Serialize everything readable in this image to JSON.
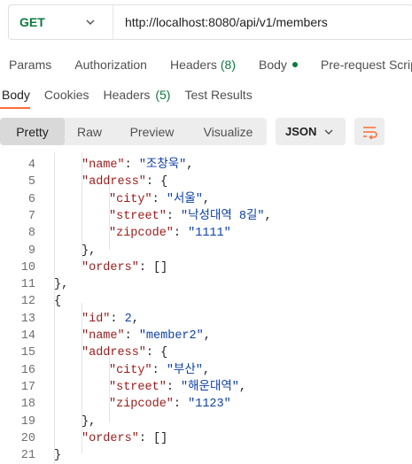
{
  "request": {
    "method": "GET",
    "url": "http://localhost:8080/api/v1/members"
  },
  "request_tabs": [
    {
      "label": "Params",
      "count": ""
    },
    {
      "label": "Authorization",
      "count": ""
    },
    {
      "label": "Headers",
      "count": "(8)"
    },
    {
      "label": "Body",
      "count": ""
    },
    {
      "label": "Pre-request Script",
      "count": ""
    }
  ],
  "response_tabs": [
    {
      "label": "Body",
      "count": ""
    },
    {
      "label": "Cookies",
      "count": ""
    },
    {
      "label": "Headers",
      "count": "(5)"
    },
    {
      "label": "Test Results",
      "count": ""
    }
  ],
  "format_toolbar": {
    "views": [
      "Pretty",
      "Raw",
      "Preview",
      "Visualize"
    ],
    "language": "JSON"
  },
  "code_lines": [
    {
      "n": "4",
      "indent": 2,
      "tokens": [
        [
          "k",
          "\"name\""
        ],
        [
          "p",
          ": "
        ],
        [
          "s",
          "\"조창욱\""
        ],
        [
          "p",
          ","
        ]
      ]
    },
    {
      "n": "5",
      "indent": 2,
      "tokens": [
        [
          "k",
          "\"address\""
        ],
        [
          "p",
          ": {"
        ]
      ]
    },
    {
      "n": "6",
      "indent": 3,
      "tokens": [
        [
          "k",
          "\"city\""
        ],
        [
          "p",
          ": "
        ],
        [
          "s",
          "\"서울\""
        ],
        [
          "p",
          ","
        ]
      ]
    },
    {
      "n": "7",
      "indent": 3,
      "tokens": [
        [
          "k",
          "\"street\""
        ],
        [
          "p",
          ": "
        ],
        [
          "s",
          "\"낙성대역 8길\""
        ],
        [
          "p",
          ","
        ]
      ]
    },
    {
      "n": "8",
      "indent": 3,
      "tokens": [
        [
          "k",
          "\"zipcode\""
        ],
        [
          "p",
          ": "
        ],
        [
          "s",
          "\"1111\""
        ]
      ]
    },
    {
      "n": "9",
      "indent": 2,
      "tokens": [
        [
          "p",
          "},"
        ]
      ]
    },
    {
      "n": "10",
      "indent": 2,
      "tokens": [
        [
          "k",
          "\"orders\""
        ],
        [
          "p",
          ": []"
        ]
      ]
    },
    {
      "n": "11",
      "indent": 1,
      "tokens": [
        [
          "p",
          "},"
        ]
      ]
    },
    {
      "n": "12",
      "indent": 1,
      "tokens": [
        [
          "p",
          "{"
        ]
      ]
    },
    {
      "n": "13",
      "indent": 2,
      "tokens": [
        [
          "k",
          "\"id\""
        ],
        [
          "p",
          ": "
        ],
        [
          "n",
          "2"
        ],
        [
          "p",
          ","
        ]
      ]
    },
    {
      "n": "14",
      "indent": 2,
      "tokens": [
        [
          "k",
          "\"name\""
        ],
        [
          "p",
          ": "
        ],
        [
          "s",
          "\"member2\""
        ],
        [
          "p",
          ","
        ]
      ]
    },
    {
      "n": "15",
      "indent": 2,
      "tokens": [
        [
          "k",
          "\"address\""
        ],
        [
          "p",
          ": {"
        ]
      ]
    },
    {
      "n": "16",
      "indent": 3,
      "tokens": [
        [
          "k",
          "\"city\""
        ],
        [
          "p",
          ": "
        ],
        [
          "s",
          "\"부산\""
        ],
        [
          "p",
          ","
        ]
      ]
    },
    {
      "n": "17",
      "indent": 3,
      "tokens": [
        [
          "k",
          "\"street\""
        ],
        [
          "p",
          ": "
        ],
        [
          "s",
          "\"해운대역\""
        ],
        [
          "p",
          ","
        ]
      ]
    },
    {
      "n": "18",
      "indent": 3,
      "tokens": [
        [
          "k",
          "\"zipcode\""
        ],
        [
          "p",
          ": "
        ],
        [
          "s",
          "\"1123\""
        ]
      ]
    },
    {
      "n": "19",
      "indent": 2,
      "tokens": [
        [
          "p",
          "},"
        ]
      ]
    },
    {
      "n": "20",
      "indent": 2,
      "tokens": [
        [
          "k",
          "\"orders\""
        ],
        [
          "p",
          ": []"
        ]
      ]
    },
    {
      "n": "21",
      "indent": 1,
      "tokens": [
        [
          "p",
          "}"
        ]
      ]
    }
  ],
  "colors": {
    "method_get": "#0b7a3e",
    "accent": "#ff6c37",
    "json_key": "#9b1a1a",
    "json_value": "#0b3fa6"
  }
}
